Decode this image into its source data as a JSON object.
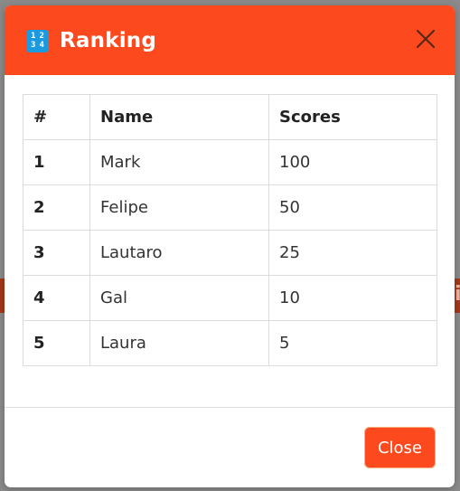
{
  "modal": {
    "title": "Ranking",
    "icon": "input-numbers-icon",
    "icon_digits": [
      "1",
      "2",
      "3",
      "4"
    ],
    "close_button_label": "Close"
  },
  "table": {
    "headers": [
      "#",
      "Name",
      "Scores"
    ],
    "rows": [
      {
        "rank": "1",
        "name": "Mark",
        "score": "100"
      },
      {
        "rank": "2",
        "name": "Felipe",
        "score": "50"
      },
      {
        "rank": "3",
        "name": "Lautaro",
        "score": "25"
      },
      {
        "rank": "4",
        "name": "Gal",
        "score": "10"
      },
      {
        "rank": "5",
        "name": "Laura",
        "score": "5"
      }
    ]
  },
  "colors": {
    "accent": "#fc4a1e",
    "icon_background": "#1b9ae0",
    "overlay": "#8a8a8a"
  }
}
